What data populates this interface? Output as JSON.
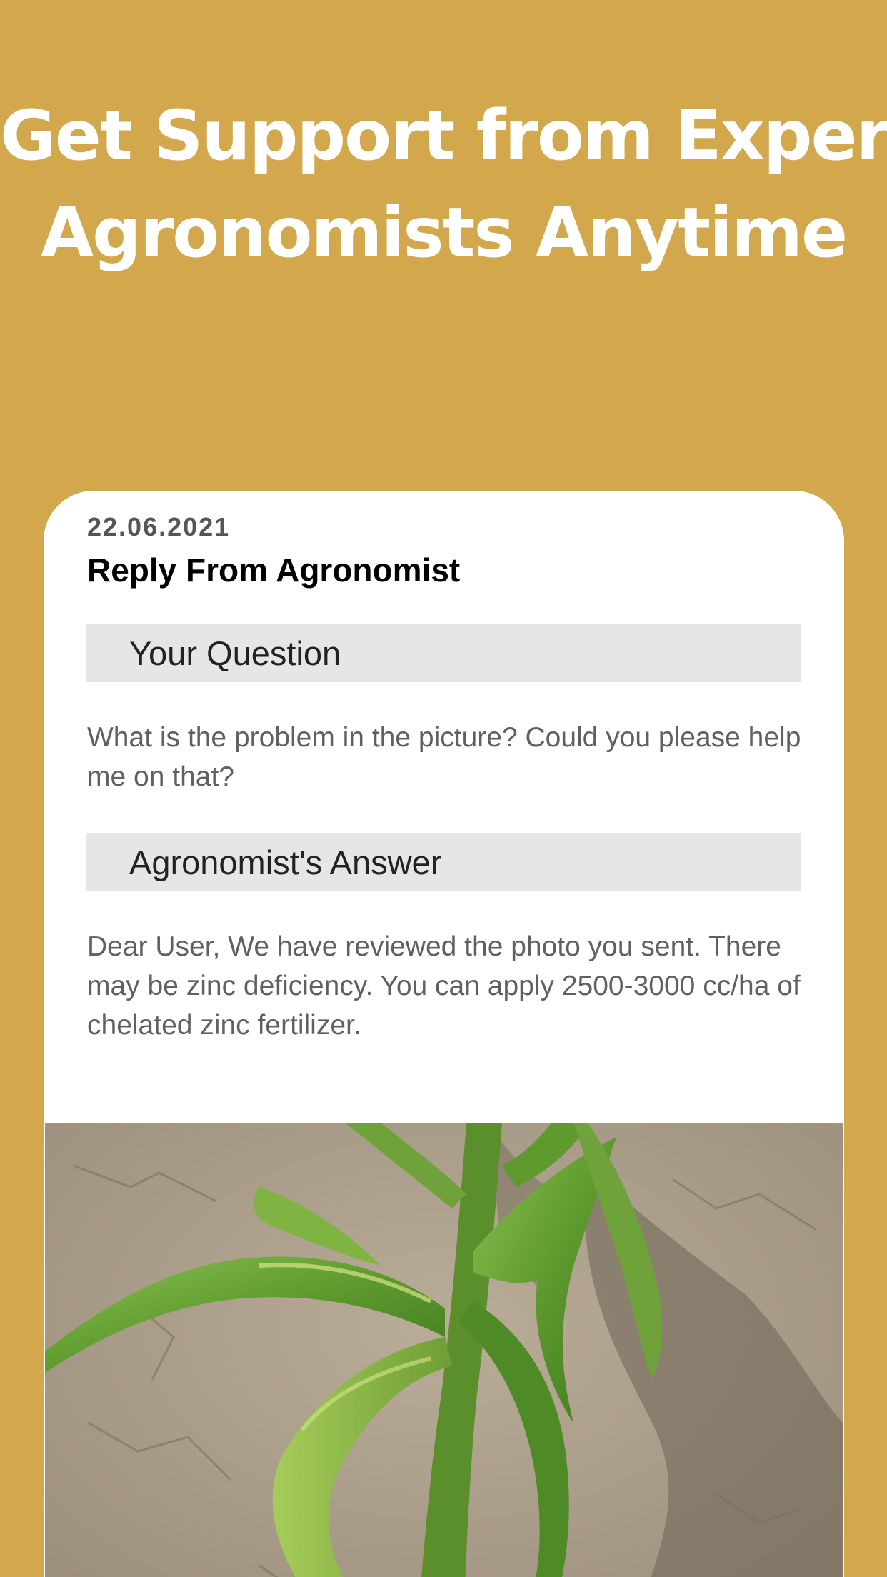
{
  "headline": {
    "line1": "Get Support from Expert",
    "line2": "Agronomists Anytime"
  },
  "card": {
    "date": "22.06.2021",
    "title": "Reply From Agronomist",
    "question_header": "Your Question",
    "question_text": "What is the problem in the picture? Could you please help me on that?",
    "answer_header": "Agronomist's Answer",
    "answer_text": "Dear User, We have reviewed the photo you sent. There may be zinc deficiency. You can apply 2500-3000 cc/ha of chelated zinc fertilizer."
  },
  "colors": {
    "background": "#D3A84D",
    "card": "#FFFFFF",
    "section_bar": "#E6E6E6",
    "leaf": "#6FA23A",
    "soil": "#A89A86"
  }
}
